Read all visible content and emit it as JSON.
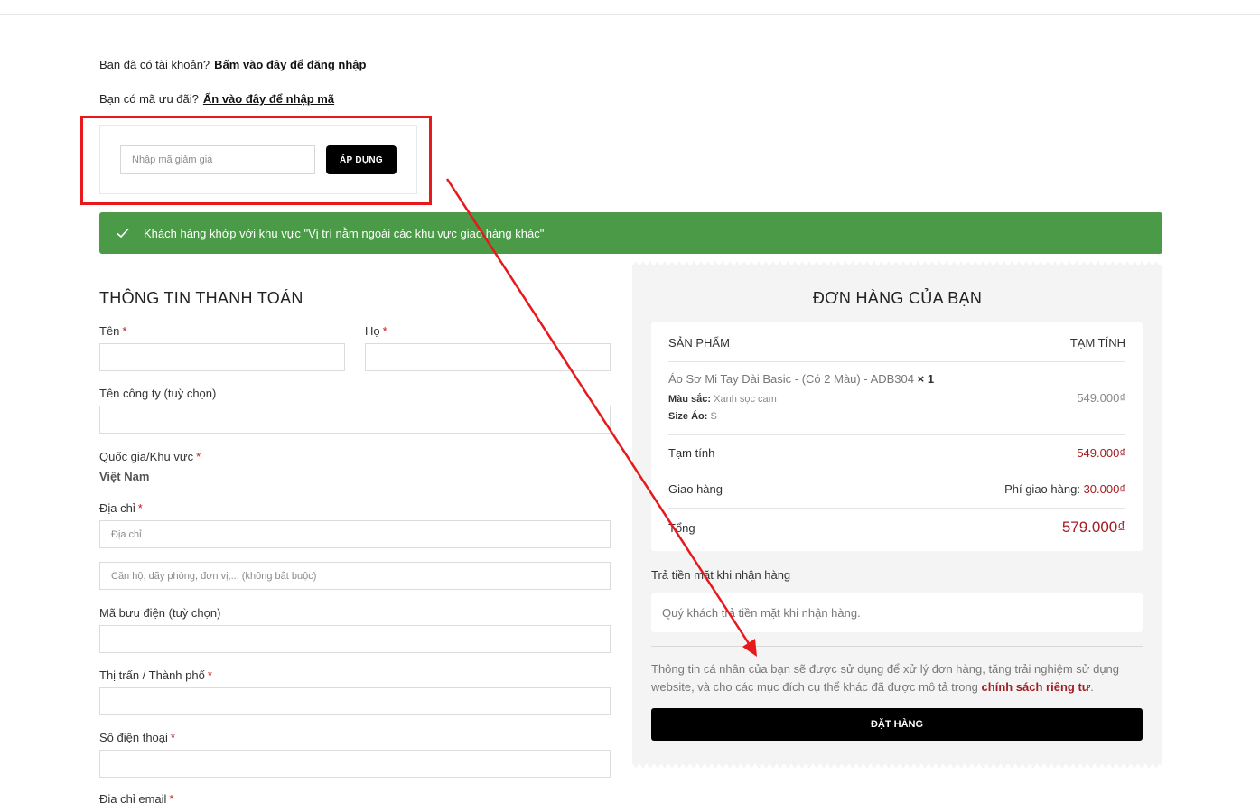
{
  "login_notice": {
    "text": "Bạn đã có tài khoản?",
    "link": "Bấm vào đây để đăng nhập"
  },
  "coupon_notice": {
    "text": "Bạn có mã ưu đãi?",
    "link": "Ấn vào đây để nhập mã"
  },
  "coupon": {
    "placeholder": "Nhập mã giảm giá",
    "button": "ÁP DỤNG"
  },
  "success_message": "Khách hàng khớp với khu vực \"Vị trí nằm ngoài các khu vực giao hàng khác\"",
  "billing": {
    "title": "THÔNG TIN THANH TOÁN",
    "required_mark": "*",
    "first_name_label": "Tên",
    "last_name_label": "Họ",
    "company_label": "Tên công ty (tuỳ chọn)",
    "country_label": "Quốc gia/Khu vực",
    "country_value": "Việt Nam",
    "address_label": "Địa chỉ",
    "address_placeholder": "Địa chỉ",
    "address2_placeholder": "Căn hộ, dãy phòng, đơn vị,... (không bắt buộc)",
    "postcode_label": "Mã bưu điện (tuỳ chọn)",
    "city_label": "Thị trấn / Thành phố",
    "phone_label": "Số điện thoại",
    "email_label": "Địa chỉ email"
  },
  "order": {
    "title": "ĐƠN HÀNG CỦA BẠN",
    "col_product": "SẢN PHẨM",
    "col_subtotal": "TẠM TÍNH",
    "product_name": "Áo Sơ Mi Tay Dài Basic - (Có 2 Màu) - ADB304",
    "product_qty": "× 1",
    "color_label": "Màu sắc:",
    "color_value": "Xanh sọc cam",
    "size_label": "Size Áo:",
    "size_value": "S",
    "product_price": "549.000₫",
    "subtotal_label": "Tạm tính",
    "subtotal_value": "549.000₫",
    "shipping_label": "Giao hàng",
    "shipping_fee_label": "Phí giao hàng:",
    "shipping_fee_value": "30.000₫",
    "total_label": "Tổng",
    "total_value": "579.000₫",
    "payment_method": "Trả tiền mặt khi nhận hàng",
    "payment_description": "Quý khách trả tiền mặt khi nhận hàng.",
    "privacy_text": "Thông tin cá nhân của bạn sẽ được sử dụng để xử lý đơn hàng, tăng trải nghiệm sử dụng website, và cho các mục đích cụ thể khác đã được mô tả trong",
    "privacy_link": "chính sách riêng tư",
    "privacy_end": ".",
    "place_order": "ĐẶT HÀNG"
  },
  "colors": {
    "accent_red": "#a21c22",
    "success_green": "#4a9a47",
    "annotation_red": "#e8191c"
  }
}
